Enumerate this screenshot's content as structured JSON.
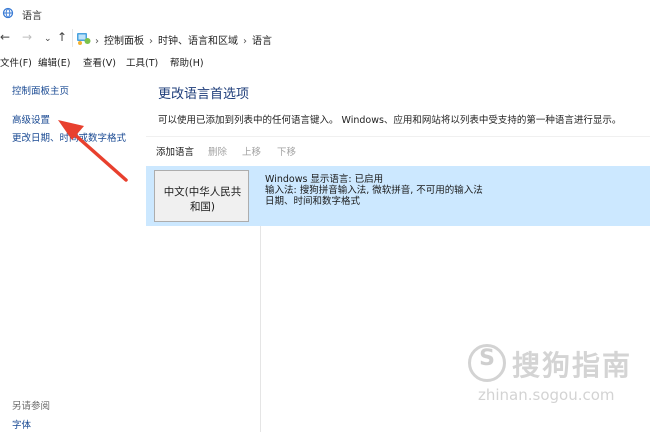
{
  "window": {
    "title": "语言"
  },
  "address": {
    "crumbs": [
      "控制面板",
      "时钟、语言和区域",
      "语言"
    ]
  },
  "menu": {
    "file": "文件(F)",
    "edit": "编辑(E)",
    "view": "查看(V)",
    "tools": "工具(T)",
    "help": "帮助(H)"
  },
  "sidebar": {
    "home": "控制面板主页",
    "advanced": "高级设置",
    "date_time": "更改日期、时间或数字格式",
    "see_also": "另请参阅",
    "fonts": "字体"
  },
  "main": {
    "heading": "更改语言首选项",
    "description": "可以使用已添加到列表中的任何语言键入。 Windows、应用和网站将以列表中受支持的第一种语言进行显示。"
  },
  "toolbar": {
    "add": "添加语言",
    "remove": "删除",
    "up": "上移",
    "down": "下移"
  },
  "language": {
    "name_line1": "中文(中华人民共",
    "name_line2": "和国)",
    "info_line1": "Windows 显示语言: 已启用",
    "info_line2": "输入法: 搜狗拼音输入法, 微软拼音, 不可用的输入法",
    "info_line3": "日期、时间和数字格式"
  },
  "watermark": {
    "name": "搜狗指南",
    "url": "zhinan.sogou.com"
  },
  "colors": {
    "selected_row": "#cce8ff",
    "heading": "#1e3d7a",
    "link": "#1a4a93",
    "arrow": "#e8402e"
  },
  "icons": {
    "back": "arrow-left-icon",
    "forward": "arrow-right-icon",
    "recent": "chevron-down-icon",
    "up": "arrow-up-icon",
    "control_panel": "control-panel-icon"
  }
}
